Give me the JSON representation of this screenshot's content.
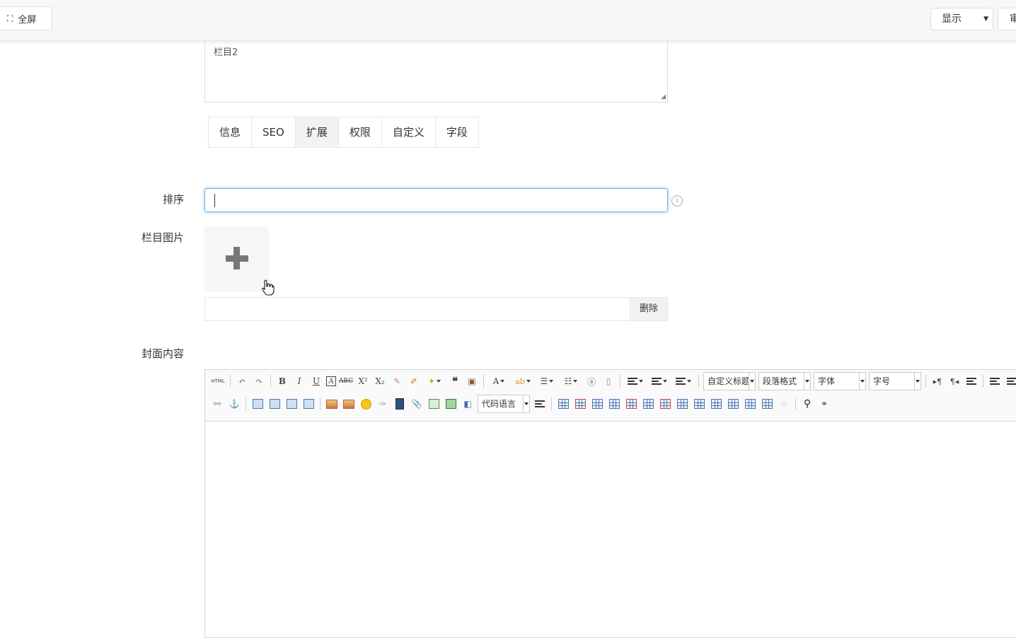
{
  "topbar": {
    "fullscreen_label": "全屏",
    "fullscreen_icon": "expand-icon",
    "display_select": "显示",
    "extra_button_partial": "审"
  },
  "textarea": {
    "value": "栏目2"
  },
  "tabs": [
    {
      "label": "信息",
      "active": false
    },
    {
      "label": "SEO",
      "active": false
    },
    {
      "label": "扩展",
      "active": true
    },
    {
      "label": "权限",
      "active": false
    },
    {
      "label": "自定义",
      "active": false
    },
    {
      "label": "字段",
      "active": false
    }
  ],
  "form": {
    "sort_label": "排序",
    "sort_value": "",
    "image_label": "栏目图片",
    "image_path": "",
    "delete_button": "删除",
    "content_label": "封面内容"
  },
  "editor": {
    "html_button": "HTML",
    "combo_title": "自定义标题",
    "combo_paragraph": "段落格式",
    "combo_font": "字体",
    "combo_size": "字号",
    "combo_code": "代码语言",
    "content": ""
  },
  "colors": {
    "focus_border": "#66afe9",
    "active_tab": "#f2f2f2",
    "topbar_bg": "#f7f7f7"
  }
}
